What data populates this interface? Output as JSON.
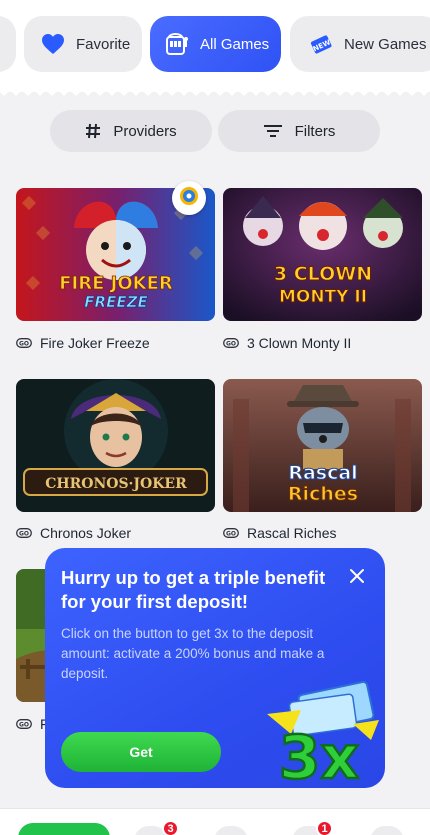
{
  "categories": [
    {
      "label": "",
      "icon": "category-icon"
    },
    {
      "label": "Favorite",
      "icon": "heart-icon"
    },
    {
      "label": "All Games",
      "icon": "slot-machine-icon",
      "active": true
    },
    {
      "label": "New Games",
      "icon": "new-ticket-icon"
    }
  ],
  "toolbar": {
    "providers_label": "Providers",
    "filters_label": "Filters"
  },
  "games": [
    {
      "name": "Fire Joker Freeze",
      "art_title": "FIRE JOKER",
      "art_subtitle": "FREEZE"
    },
    {
      "name": "3 Clown Monty II",
      "art_title": "3 CLOWN",
      "art_subtitle": "MONTY II"
    },
    {
      "name": "Chronos Joker",
      "art_title": "CHRONOS·JOKER",
      "art_subtitle": ""
    },
    {
      "name": "Rascal Riches",
      "art_title": "Rascal",
      "art_subtitle": "Riches"
    },
    {
      "name": "F",
      "art_title": "",
      "art_subtitle": ""
    }
  ],
  "popup": {
    "title": "Hurry up to get a triple benefit for your first deposit!",
    "text": "Click on the button to get 3x to the deposit amount: activate a 200% bonus and make a deposit.",
    "button_label": "Get",
    "art_text": "3x"
  },
  "bottom_bar": {
    "badges": [
      "3",
      "1"
    ]
  },
  "colors": {
    "accent": "#3355f6",
    "green": "#22c34a",
    "badge_red": "#e8192c"
  }
}
